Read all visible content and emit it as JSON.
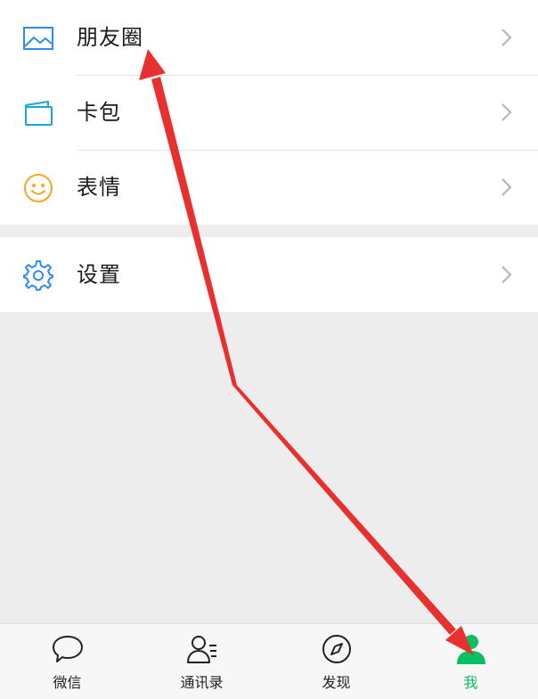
{
  "menu": {
    "items": [
      {
        "label": "朋友圈",
        "icon": "moments-icon",
        "icon_color": "#2d8cf0"
      },
      {
        "label": "卡包",
        "icon": "card-wallet-icon",
        "icon_color": "#1aa8d6"
      },
      {
        "label": "表情",
        "icon": "emoji-icon",
        "icon_color": "#f5a623"
      },
      {
        "label": "设置",
        "icon": "settings-icon",
        "icon_color": "#2d8cf0"
      }
    ]
  },
  "tabbar": {
    "tabs": [
      {
        "label": "微信",
        "icon": "chat-bubble-icon",
        "active": false
      },
      {
        "label": "通讯录",
        "icon": "contacts-icon",
        "active": false
      },
      {
        "label": "发现",
        "icon": "discover-compass-icon",
        "active": false
      },
      {
        "label": "我",
        "icon": "me-person-icon",
        "active": true
      }
    ],
    "active_color": "#07c160"
  },
  "annotation": {
    "arrow_color": "#e8312f"
  }
}
